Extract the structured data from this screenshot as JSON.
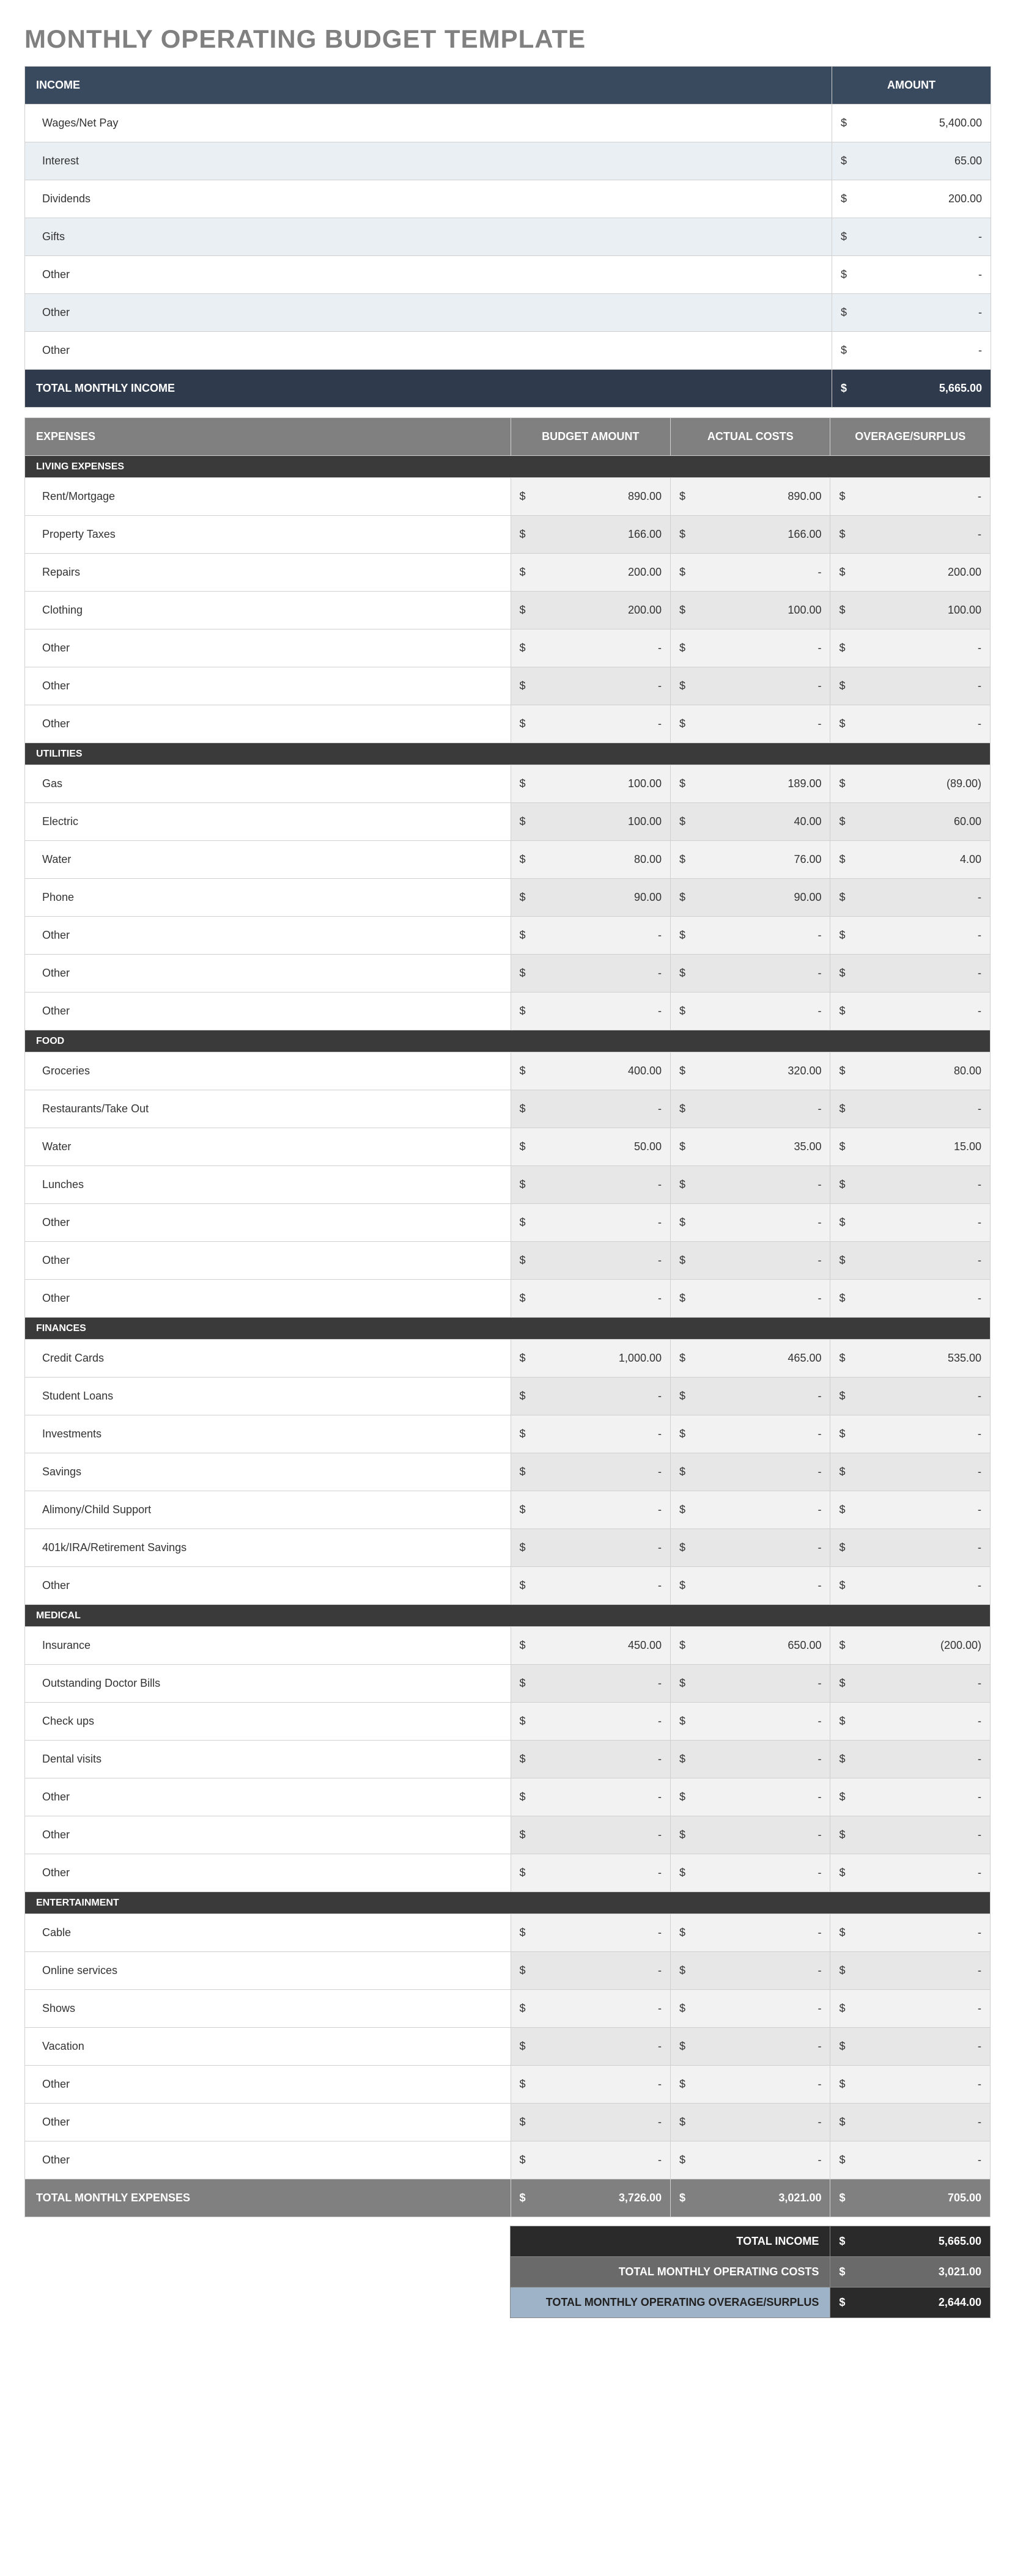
{
  "title": "MONTHLY OPERATING BUDGET TEMPLATE",
  "income": {
    "header_label": "INCOME",
    "header_amount": "AMOUNT",
    "rows": [
      {
        "label": "Wages/Net Pay",
        "amount": "5,400.00"
      },
      {
        "label": "Interest",
        "amount": "65.00"
      },
      {
        "label": "Dividends",
        "amount": "200.00"
      },
      {
        "label": "Gifts",
        "amount": "-"
      },
      {
        "label": "Other",
        "amount": "-"
      },
      {
        "label": "Other",
        "amount": "-"
      },
      {
        "label": "Other",
        "amount": "-"
      }
    ],
    "total_label": "TOTAL MONTHLY INCOME",
    "total_amount": "5,665.00"
  },
  "expenses": {
    "header_label": "EXPENSES",
    "col_budget": "BUDGET AMOUNT",
    "col_actual": "ACTUAL COSTS",
    "col_overage": "OVERAGE/SURPLUS",
    "categories": [
      {
        "name": "LIVING EXPENSES",
        "rows": [
          {
            "label": "Rent/Mortgage",
            "budget": "890.00",
            "actual": "890.00",
            "overage": "-"
          },
          {
            "label": "Property Taxes",
            "budget": "166.00",
            "actual": "166.00",
            "overage": "-"
          },
          {
            "label": "Repairs",
            "budget": "200.00",
            "actual": "-",
            "overage": "200.00"
          },
          {
            "label": "Clothing",
            "budget": "200.00",
            "actual": "100.00",
            "overage": "100.00"
          },
          {
            "label": "Other",
            "budget": "-",
            "actual": "-",
            "overage": "-"
          },
          {
            "label": "Other",
            "budget": "-",
            "actual": "-",
            "overage": "-"
          },
          {
            "label": "Other",
            "budget": "-",
            "actual": "-",
            "overage": "-"
          }
        ]
      },
      {
        "name": "UTILITIES",
        "rows": [
          {
            "label": "Gas",
            "budget": "100.00",
            "actual": "189.00",
            "overage": "(89.00)"
          },
          {
            "label": "Electric",
            "budget": "100.00",
            "actual": "40.00",
            "overage": "60.00"
          },
          {
            "label": "Water",
            "budget": "80.00",
            "actual": "76.00",
            "overage": "4.00"
          },
          {
            "label": "Phone",
            "budget": "90.00",
            "actual": "90.00",
            "overage": "-"
          },
          {
            "label": "Other",
            "budget": "-",
            "actual": "-",
            "overage": "-"
          },
          {
            "label": "Other",
            "budget": "-",
            "actual": "-",
            "overage": "-"
          },
          {
            "label": "Other",
            "budget": "-",
            "actual": "-",
            "overage": "-"
          }
        ]
      },
      {
        "name": "FOOD",
        "rows": [
          {
            "label": "Groceries",
            "budget": "400.00",
            "actual": "320.00",
            "overage": "80.00"
          },
          {
            "label": "Restaurants/Take Out",
            "budget": "-",
            "actual": "-",
            "overage": "-"
          },
          {
            "label": "Water",
            "budget": "50.00",
            "actual": "35.00",
            "overage": "15.00"
          },
          {
            "label": "Lunches",
            "budget": "-",
            "actual": "-",
            "overage": "-"
          },
          {
            "label": "Other",
            "budget": "-",
            "actual": "-",
            "overage": "-"
          },
          {
            "label": "Other",
            "budget": "-",
            "actual": "-",
            "overage": "-"
          },
          {
            "label": "Other",
            "budget": "-",
            "actual": "-",
            "overage": "-"
          }
        ]
      },
      {
        "name": "FINANCES",
        "rows": [
          {
            "label": "Credit Cards",
            "budget": "1,000.00",
            "actual": "465.00",
            "overage": "535.00"
          },
          {
            "label": "Student Loans",
            "budget": "-",
            "actual": "-",
            "overage": "-"
          },
          {
            "label": "Investments",
            "budget": "-",
            "actual": "-",
            "overage": "-"
          },
          {
            "label": "Savings",
            "budget": "-",
            "actual": "-",
            "overage": "-"
          },
          {
            "label": "Alimony/Child Support",
            "budget": "-",
            "actual": "-",
            "overage": "-"
          },
          {
            "label": "401k/IRA/Retirement Savings",
            "budget": "-",
            "actual": "-",
            "overage": "-"
          },
          {
            "label": "Other",
            "budget": "-",
            "actual": "-",
            "overage": "-"
          }
        ]
      },
      {
        "name": "MEDICAL",
        "rows": [
          {
            "label": "Insurance",
            "budget": "450.00",
            "actual": "650.00",
            "overage": "(200.00)"
          },
          {
            "label": "Outstanding Doctor Bills",
            "budget": "-",
            "actual": "-",
            "overage": "-"
          },
          {
            "label": "Check ups",
            "budget": "-",
            "actual": "-",
            "overage": "-"
          },
          {
            "label": "Dental visits",
            "budget": "-",
            "actual": "-",
            "overage": "-"
          },
          {
            "label": "Other",
            "budget": "-",
            "actual": "-",
            "overage": "-"
          },
          {
            "label": "Other",
            "budget": "-",
            "actual": "-",
            "overage": "-"
          },
          {
            "label": "Other",
            "budget": "-",
            "actual": "-",
            "overage": "-"
          }
        ]
      },
      {
        "name": "ENTERTAINMENT",
        "rows": [
          {
            "label": "Cable",
            "budget": "-",
            "actual": "-",
            "overage": "-"
          },
          {
            "label": "Online services",
            "budget": "-",
            "actual": "-",
            "overage": "-"
          },
          {
            "label": "Shows",
            "budget": "-",
            "actual": "-",
            "overage": "-"
          },
          {
            "label": "Vacation",
            "budget": "-",
            "actual": "-",
            "overage": "-"
          },
          {
            "label": "Other",
            "budget": "-",
            "actual": "-",
            "overage": "-"
          },
          {
            "label": "Other",
            "budget": "-",
            "actual": "-",
            "overage": "-"
          },
          {
            "label": "Other",
            "budget": "-",
            "actual": "-",
            "overage": "-"
          }
        ]
      }
    ],
    "total_label": "TOTAL MONTHLY EXPENSES",
    "total_budget": "3,726.00",
    "total_actual": "3,021.00",
    "total_overage": "705.00"
  },
  "summary": {
    "row1_label": "TOTAL INCOME",
    "row1_amount": "5,665.00",
    "row2_label": "TOTAL MONTHLY OPERATING COSTS",
    "row2_amount": "3,021.00",
    "row3_label": "TOTAL MONTHLY OPERATING OVERAGE/SURPLUS",
    "row3_amount": "2,644.00"
  },
  "currency": "$"
}
